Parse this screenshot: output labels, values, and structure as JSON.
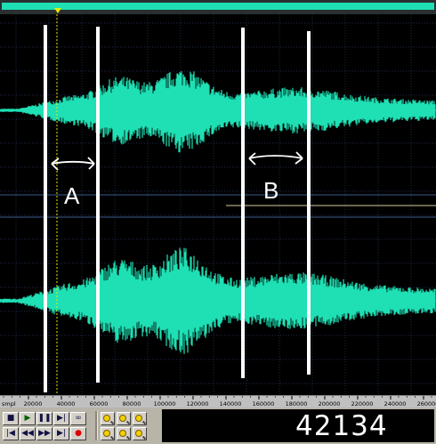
{
  "colors": {
    "waveform": "#1ee0b4",
    "background": "#000000",
    "grid": "#1c2a4a",
    "annotation": "#ffffff",
    "playhead": "#e8e800",
    "center_line": "#1a6e5a"
  },
  "ruler": {
    "unit_label": "smpl",
    "ticks": [
      "20000",
      "40000",
      "60000",
      "80000",
      "100000",
      "120000",
      "140000",
      "160000",
      "180000",
      "200000",
      "220000",
      "240000",
      "260000",
      "280000",
      "300000",
      "320000"
    ]
  },
  "annotations": {
    "region_a_label": "A",
    "region_b_label": "B"
  },
  "transport": {
    "buttons": [
      {
        "name": "stop-button",
        "icon": "stop-icon",
        "glyph": "■"
      },
      {
        "name": "play-button",
        "icon": "play-icon",
        "glyph": "▶"
      },
      {
        "name": "pause-button",
        "icon": "pause-icon",
        "glyph": "❚❚"
      },
      {
        "name": "play-to-end-button",
        "icon": "play-to-end-icon",
        "glyph": "▶|"
      },
      {
        "name": "loop-button",
        "icon": "loop-icon",
        "glyph": "∞"
      },
      {
        "name": "go-to-start-button",
        "icon": "go-to-start-icon",
        "glyph": "|◀"
      },
      {
        "name": "rewind-button",
        "icon": "rewind-icon",
        "glyph": "◀◀"
      },
      {
        "name": "fast-forward-button",
        "icon": "fast-forward-icon",
        "glyph": "▶▶"
      },
      {
        "name": "go-to-end-button",
        "icon": "go-to-end-icon",
        "glyph": "▶|"
      },
      {
        "name": "record-button",
        "icon": "record-icon",
        "glyph": "●"
      }
    ],
    "zoom_buttons": [
      {
        "name": "zoom-in-horizontal-button",
        "icon": "zoom-in-icon"
      },
      {
        "name": "zoom-out-horizontal-button",
        "icon": "zoom-out-icon"
      },
      {
        "name": "zoom-full-button",
        "icon": "zoom-full-icon"
      },
      {
        "name": "zoom-in-vertical-button",
        "icon": "zoom-in-vertical-icon"
      },
      {
        "name": "zoom-out-vertical-button",
        "icon": "zoom-out-vertical-icon"
      },
      {
        "name": "zoom-selection-button",
        "icon": "zoom-selection-icon"
      }
    ]
  },
  "time_display": {
    "value": "42134"
  }
}
